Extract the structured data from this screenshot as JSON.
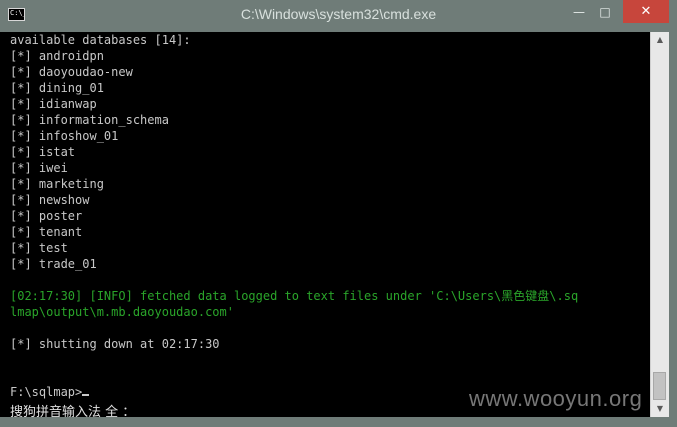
{
  "window": {
    "title": "C:\\Windows\\system32\\cmd.exe",
    "icon_text": "C:\\_",
    "controls": {
      "minimize": "—",
      "maximize": "□",
      "close": "✕"
    }
  },
  "console": {
    "lines": [
      {
        "text": "available databases [14]:",
        "type": "normal"
      },
      {
        "text": "[*] androidpn",
        "type": "normal"
      },
      {
        "text": "[*] daoyoudao-new",
        "type": "normal"
      },
      {
        "text": "[*] dining_01",
        "type": "normal"
      },
      {
        "text": "[*] idianwap",
        "type": "normal"
      },
      {
        "text": "[*] information_schema",
        "type": "normal"
      },
      {
        "text": "[*] infoshow_01",
        "type": "normal"
      },
      {
        "text": "[*] istat",
        "type": "normal"
      },
      {
        "text": "[*] iwei",
        "type": "normal"
      },
      {
        "text": "[*] marketing",
        "type": "normal"
      },
      {
        "text": "[*] newshow",
        "type": "normal"
      },
      {
        "text": "[*] poster",
        "type": "normal"
      },
      {
        "text": "[*] tenant",
        "type": "normal"
      },
      {
        "text": "[*] test",
        "type": "normal"
      },
      {
        "text": "[*] trade_01",
        "type": "normal"
      },
      {
        "text": "",
        "type": "normal"
      },
      {
        "text": "[02:17:30] [INFO] fetched data logged to text files under 'C:\\Users\\黑色键盘\\.sq",
        "type": "info"
      },
      {
        "text": "lmap\\output\\m.mb.daoyoudao.com'",
        "type": "info"
      },
      {
        "text": "",
        "type": "normal"
      },
      {
        "text": "[*] shutting down at 02:17:30",
        "type": "normal"
      },
      {
        "text": "",
        "type": "normal"
      },
      {
        "text": "",
        "type": "normal"
      },
      {
        "text": "F:\\sqlmap>",
        "type": "prompt"
      }
    ],
    "ime_status": "搜狗拼音输入法 全 ："
  },
  "watermark": "www.wooyun.org",
  "colors": {
    "console_bg": "#000000",
    "console_text": "#c8c8c8",
    "info_text": "#2aa52a",
    "titlebar": "#6f7c78",
    "close_button": "#c7463c"
  }
}
